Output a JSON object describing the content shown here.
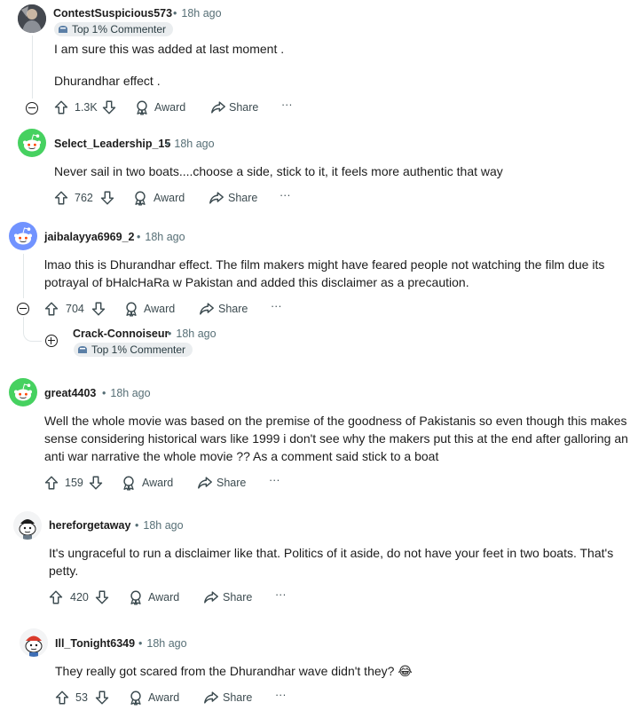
{
  "comments": [
    {
      "author": "ContestSuspicious573",
      "time": "18h ago",
      "badge": "Top 1% Commenter",
      "lines": [
        "I am sure this was added at last moment .",
        "Dhurandhar effect ."
      ],
      "votes": "1.3K",
      "avatar_icon": "user-photo-avatar"
    },
    {
      "author": "Select_Leadership_15",
      "time": "18h ago",
      "lines": [
        "Never sail in two boats....choose a side, stick to it, it feels more authentic that way"
      ],
      "votes": "762",
      "avatar_icon": "green-snoo-avatar"
    },
    {
      "author": "jaibalayya6969_2",
      "time": "18h ago",
      "lines": [
        "lmao this is Dhurandhar effect. The film makers might have feared people not watching the film due its",
        "potrayal of bHalcHaRa w Pakistan and added this disclaimer as a precaution."
      ],
      "votes": "704",
      "avatar_icon": "blue-snoo-avatar"
    },
    {
      "author": "Crack-Connoiseur",
      "time": "18h ago",
      "badge": "Top 1% Commenter",
      "collapsed": true
    },
    {
      "author": "great4403",
      "time": "18h ago",
      "lines": [
        "Well the whole movie was based on the premise of the goodness of Pakistanis so even though this makes",
        "sense considering historical wars like 1999 i don't see why the makers put this at the end after galloring an",
        "anti war narrative the whole movie ?? As a comment said stick to a boat"
      ],
      "votes": "159",
      "avatar_icon": "green-snoo-avatar"
    },
    {
      "author": "hereforgetaway",
      "time": "18h ago",
      "lines": [
        "It's ungraceful to run a disclaimer like that. Politics of it aside, do not have your feet in two boats. That's",
        "petty."
      ],
      "votes": "420",
      "avatar_icon": "snoo-character-avatar"
    },
    {
      "author": "Ill_Tonight6349",
      "time": "18h ago",
      "lines": [
        "They really got scared from the Dhurandhar wave didn't they? 😂"
      ],
      "votes": "53",
      "avatar_icon": "snoo-character-avatar"
    }
  ],
  "actions": {
    "award": "Award",
    "share": "Share",
    "more": "···"
  },
  "colors": {
    "snoo_green": "#46d160",
    "snoo_blue": "#7193ff",
    "meta_gray": "#576f76",
    "thread_line": "#e2e7e9"
  }
}
